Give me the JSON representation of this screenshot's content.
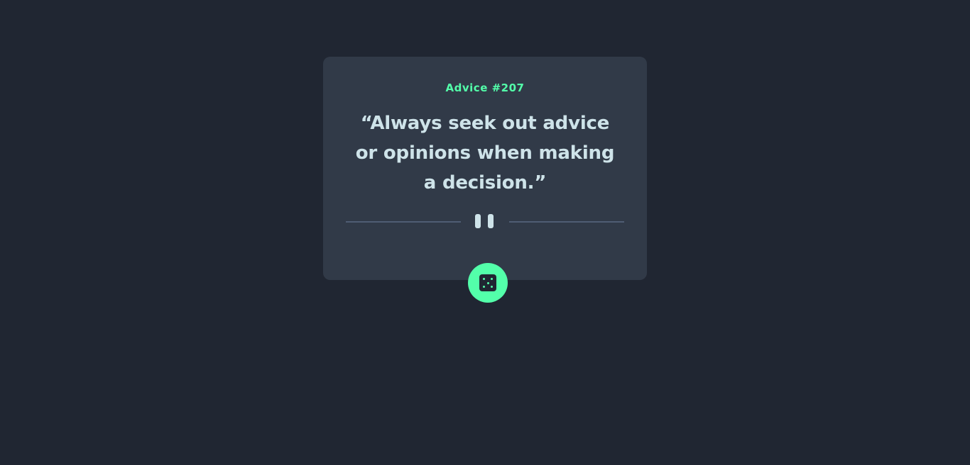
{
  "card": {
    "advice_label": "Advice #207",
    "quote": "“Always seek out advice or opinions when making a decision.”"
  },
  "icons": {
    "divider": "pause-icon",
    "action": "dice-icon"
  },
  "colors": {
    "background": "#202632",
    "card": "#313a48",
    "accent": "#53ffaa",
    "text": "#cee3e9",
    "divider": "#4f5d74"
  }
}
